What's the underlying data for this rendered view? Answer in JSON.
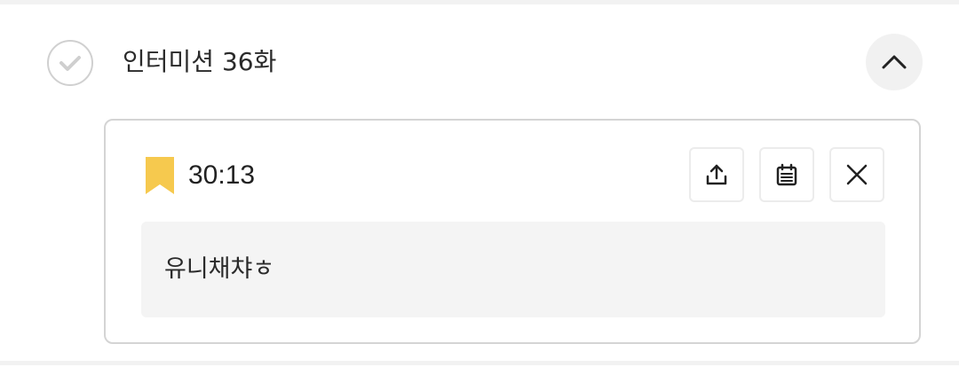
{
  "episode": {
    "title": "인터미션 36화",
    "watched_icon": "check-icon",
    "collapse_icon": "chevron-up-icon"
  },
  "memo": {
    "timestamp": "30:13",
    "text": "유니채챠ㅎ",
    "bookmark_icon": "bookmark-icon",
    "bookmark_color": "#F6C94E",
    "actions": {
      "share_icon": "share-icon",
      "calendar_icon": "calendar-icon",
      "close_icon": "close-icon"
    }
  }
}
